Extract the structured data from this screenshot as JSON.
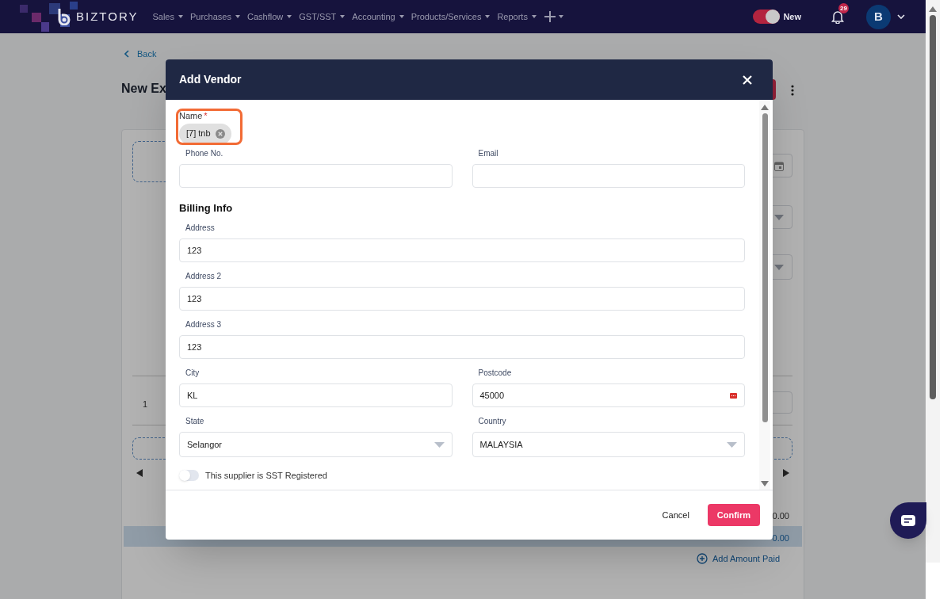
{
  "nav": {
    "brand": "BIZTORY",
    "menus": [
      {
        "label": "Sales"
      },
      {
        "label": "Purchases"
      },
      {
        "label": "Cashflow"
      },
      {
        "label": "GST/SST"
      },
      {
        "label": "Accounting"
      },
      {
        "label": "Products/Services"
      },
      {
        "label": "Reports"
      }
    ],
    "new_toggle": {
      "label": "New",
      "on": true
    },
    "notifications": {
      "count": "29"
    },
    "avatar": {
      "initial": "B"
    }
  },
  "background_page": {
    "back": "Back",
    "title": "New Ex",
    "row_number": "1",
    "amounts": [
      "0.00",
      "0.00"
    ],
    "add_amount_paid": "Add Amount Paid"
  },
  "dialog": {
    "title": "Add Vendor",
    "name": {
      "label": "Name",
      "required_mark": "*",
      "chip": "[7] tnb"
    },
    "fields_top": [
      {
        "label": "Phone No.",
        "kind": "text"
      },
      {
        "label": "Email",
        "kind": "text"
      }
    ],
    "section": "Billing Info",
    "address_fields": [
      {
        "label": "Address",
        "value": "123",
        "kind": "text"
      },
      {
        "label": "Address 2",
        "value": "123",
        "kind": "text"
      },
      {
        "label": "Address 3",
        "value": "123",
        "kind": "text"
      }
    ],
    "location_fields": [
      {
        "label": "City",
        "value": "KL",
        "kind": "text"
      },
      {
        "label": "Postcode",
        "value": "45000",
        "kind": "text"
      },
      {
        "label": "State",
        "value": "Selangor",
        "kind": "select"
      },
      {
        "label": "Country",
        "value": "MALAYSIA",
        "kind": "select"
      }
    ],
    "sst_toggle": {
      "label": "This supplier is SST Registered",
      "on": false
    },
    "buttons": [
      {
        "label": "Cancel",
        "kind": "plain"
      },
      {
        "label": "Confirm",
        "kind": "primary"
      }
    ]
  }
}
